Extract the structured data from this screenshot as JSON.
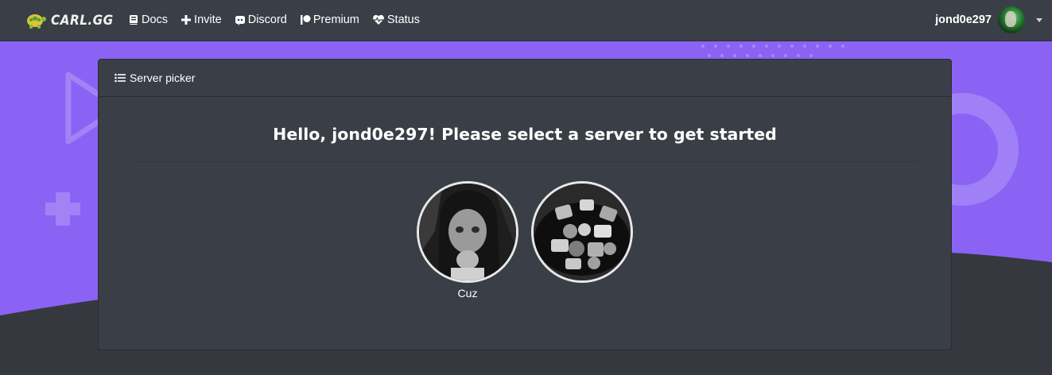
{
  "brand": {
    "name": "CARL.GG"
  },
  "nav": {
    "items": [
      {
        "label": "Docs",
        "icon": "book-icon"
      },
      {
        "label": "Invite",
        "icon": "plus-icon"
      },
      {
        "label": "Discord",
        "icon": "discord-icon"
      },
      {
        "label": "Premium",
        "icon": "patreon-icon"
      },
      {
        "label": "Status",
        "icon": "heartbeat-icon"
      }
    ]
  },
  "user": {
    "name": "jond0e297"
  },
  "card": {
    "header_label": "Server picker",
    "greeting": "Hello, jond0e297! Please select a server to get started"
  },
  "servers": [
    {
      "name": "Cuz"
    },
    {
      "name": ""
    }
  ],
  "colors": {
    "navbar": "#3a3f47",
    "page_dark": "#35393f",
    "purple": "#8a63f4",
    "card": "#3a3f47"
  }
}
